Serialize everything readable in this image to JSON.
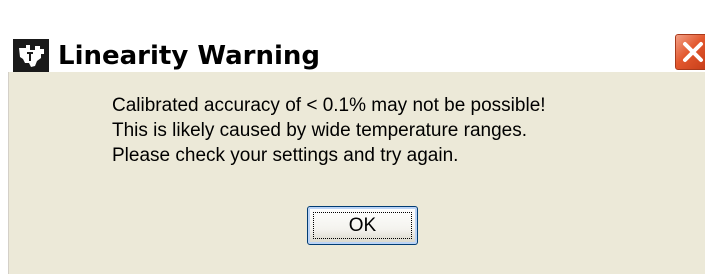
{
  "window": {
    "title": "Linearity Warning",
    "icon": "ti-logo-icon",
    "close_icon": "close-x-icon",
    "close_color": "#d9542b"
  },
  "message": {
    "lines": [
      "Calibrated accuracy of < 0.1% may not be possible!",
      "This is likely caused by wide temperature ranges.",
      "Please check your settings and try again."
    ]
  },
  "buttons": {
    "ok_label": "OK"
  },
  "colors": {
    "dialog_background": "#ece9d8",
    "button_focus_ring": "#bcd4f6"
  }
}
